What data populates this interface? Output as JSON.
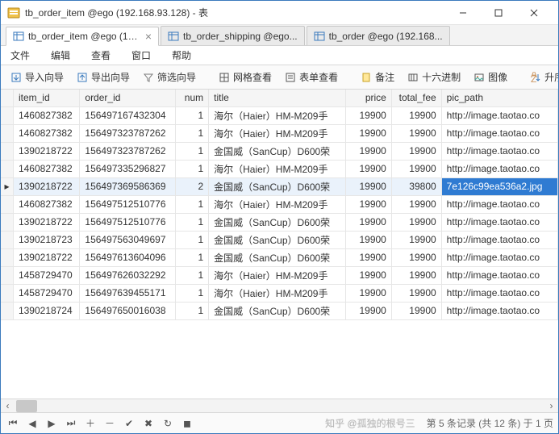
{
  "window": {
    "title": "tb_order_item @ego (192.168.93.128) - 表"
  },
  "tabs": [
    {
      "label": "tb_order_item @ego (19...",
      "active": true
    },
    {
      "label": "tb_order_shipping @ego...",
      "active": false
    },
    {
      "label": "tb_order @ego (192.168...",
      "active": false
    }
  ],
  "menu": {
    "file": "文件",
    "edit": "编辑",
    "view": "查看",
    "window": "窗口",
    "help": "帮助"
  },
  "toolbar": {
    "import": "导入向导",
    "export": "导出向导",
    "filter": "筛选向导",
    "gridview": "网格查看",
    "formview": "表单查看",
    "memo": "备注",
    "hex": "十六进制",
    "image": "图像",
    "sort": "升序排序"
  },
  "columns": [
    "item_id",
    "order_id",
    "num",
    "title",
    "price",
    "total_fee",
    "pic_path"
  ],
  "rows": [
    {
      "item_id": "1460827382",
      "order_id": "156497167432304",
      "num": "1",
      "title": "海尔（Haier）HM-M209手",
      "price": "19900",
      "total_fee": "19900",
      "pic": "http://image.taotao.co"
    },
    {
      "item_id": "1460827382",
      "order_id": "156497323787262",
      "num": "1",
      "title": "海尔（Haier）HM-M209手",
      "price": "19900",
      "total_fee": "19900",
      "pic": "http://image.taotao.co"
    },
    {
      "item_id": "1390218722",
      "order_id": "156497323787262",
      "num": "1",
      "title": "金国威（SanCup）D600荣",
      "price": "19900",
      "total_fee": "19900",
      "pic": "http://image.taotao.co"
    },
    {
      "item_id": "1460827382",
      "order_id": "156497335296827",
      "num": "1",
      "title": "海尔（Haier）HM-M209手",
      "price": "19900",
      "total_fee": "19900",
      "pic": "http://image.taotao.co"
    },
    {
      "item_id": "1390218722",
      "order_id": "156497369586369",
      "num": "2",
      "title": "金国威（SanCup）D600荣",
      "price": "19900",
      "total_fee": "39800",
      "pic": "7e126c99ea536a2.jpg"
    },
    {
      "item_id": "1460827382",
      "order_id": "156497512510776",
      "num": "1",
      "title": "海尔（Haier）HM-M209手",
      "price": "19900",
      "total_fee": "19900",
      "pic": "http://image.taotao.co"
    },
    {
      "item_id": "1390218722",
      "order_id": "156497512510776",
      "num": "1",
      "title": "金国威（SanCup）D600荣",
      "price": "19900",
      "total_fee": "19900",
      "pic": "http://image.taotao.co"
    },
    {
      "item_id": "1390218723",
      "order_id": "156497563049697",
      "num": "1",
      "title": "金国威（SanCup）D600荣",
      "price": "19900",
      "total_fee": "19900",
      "pic": "http://image.taotao.co"
    },
    {
      "item_id": "1390218722",
      "order_id": "156497613604096",
      "num": "1",
      "title": "金国威（SanCup）D600荣",
      "price": "19900",
      "total_fee": "19900",
      "pic": "http://image.taotao.co"
    },
    {
      "item_id": "1458729470",
      "order_id": "156497626032292",
      "num": "1",
      "title": "海尔（Haier）HM-M209手",
      "price": "19900",
      "total_fee": "19900",
      "pic": "http://image.taotao.co"
    },
    {
      "item_id": "1458729470",
      "order_id": "156497639455171",
      "num": "1",
      "title": "海尔（Haier）HM-M209手",
      "price": "19900",
      "total_fee": "19900",
      "pic": "http://image.taotao.co"
    },
    {
      "item_id": "1390218724",
      "order_id": "156497650016038",
      "num": "1",
      "title": "金国威（SanCup）D600荣",
      "price": "19900",
      "total_fee": "19900",
      "pic": "http://image.taotao.co"
    }
  ],
  "selected_row": 4,
  "status": "第 5 条记录 (共 12 条) 于 1 页",
  "watermark": "知乎 @孤独的根号三"
}
